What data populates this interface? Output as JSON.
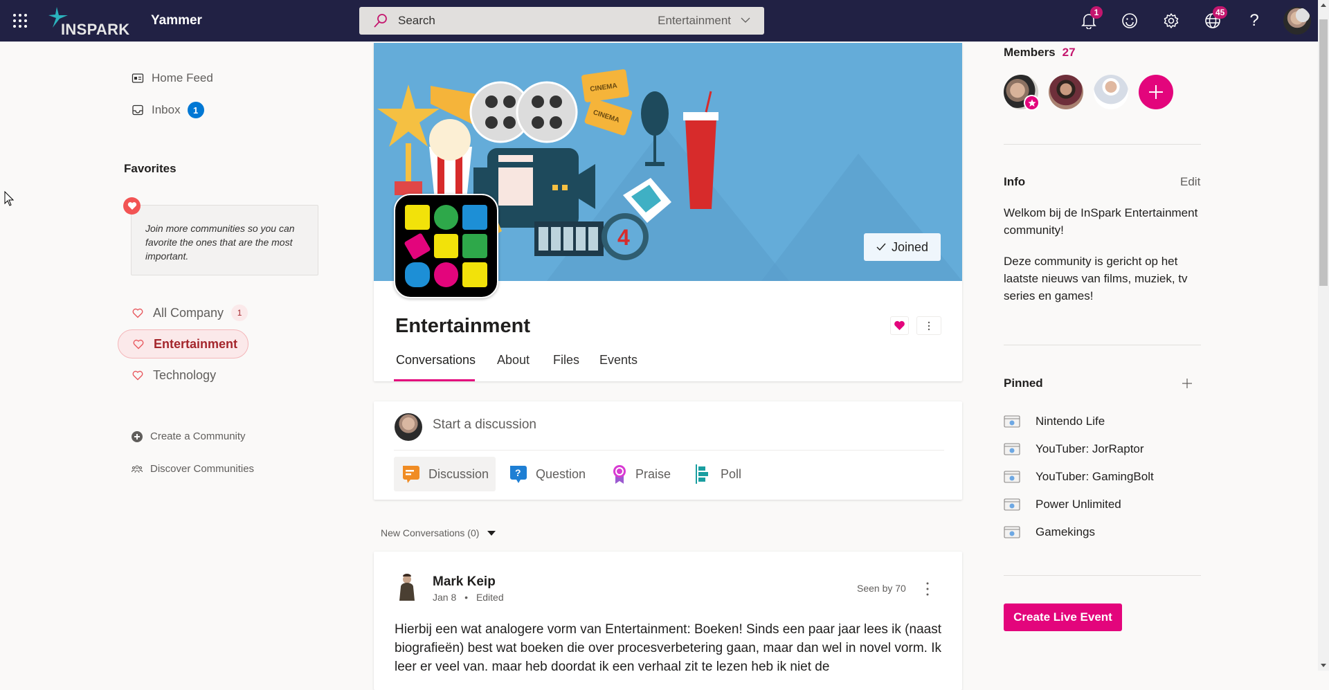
{
  "topbar": {
    "brand": "INSPARK",
    "app_name": "Yammer",
    "search": {
      "placeholder": "Search",
      "scope": "Entertainment"
    },
    "notifications_badge": "1",
    "globe_badge": "45",
    "icons": [
      "waffle-icon",
      "bell-icon",
      "smiley-icon",
      "gear-icon",
      "globe-icon",
      "help-icon"
    ]
  },
  "sidebar": {
    "nav": [
      {
        "label": "Home Feed",
        "icon": "news-icon"
      },
      {
        "label": "Inbox",
        "icon": "inbox-icon",
        "badge": "1"
      }
    ],
    "favorites_title": "Favorites",
    "favorites_tip": "Join more communities so you can favorite the ones that are the most important.",
    "communities": [
      {
        "label": "All Company",
        "count": "1",
        "active": false
      },
      {
        "label": "Entertainment",
        "active": true
      },
      {
        "label": "Technology",
        "active": false
      }
    ],
    "actions": [
      {
        "label": "Create a Community",
        "icon": "plus-circle-icon"
      },
      {
        "label": "Discover Communities",
        "icon": "people-icon"
      }
    ]
  },
  "community": {
    "name": "Entertainment",
    "joined_label": "Joined",
    "tabs": [
      {
        "label": "Conversations",
        "active": true
      },
      {
        "label": "About",
        "active": false
      },
      {
        "label": "Files",
        "active": false
      },
      {
        "label": "Events",
        "active": false
      }
    ],
    "colors": {
      "accent": "#e3057c",
      "banner": "#64acd9"
    }
  },
  "composer": {
    "placeholder": "Start a discussion",
    "types": [
      {
        "label": "Discussion",
        "active": true
      },
      {
        "label": "Question",
        "active": false
      },
      {
        "label": "Praise",
        "active": false
      },
      {
        "label": "Poll",
        "active": false
      }
    ]
  },
  "feed": {
    "filter_label": "New Conversations (0)",
    "posts": [
      {
        "author": "Mark Keip",
        "date": "Jan 8",
        "edited": "Edited",
        "seen": "Seen by 70",
        "body": "Hierbij een wat analogere vorm van Entertainment: Boeken! Sinds een paar jaar lees ik (naast biografieën) best wat boeken die over procesverbetering gaan, maar dan wel in novel vorm. Ik leer er veel van, maar heb doordat ik een verhaal zit te lezen heb ik niet de"
      }
    ]
  },
  "rightpanel": {
    "members_title": "Members",
    "members_count": "27",
    "info_title": "Info",
    "edit_label": "Edit",
    "info_paragraphs": [
      "Welkom bij de InSpark Entertainment community!",
      "Deze community is gericht op het laatste nieuws van films, muziek, tv series en games!"
    ],
    "pinned_title": "Pinned",
    "pinned": [
      "Nintendo Life",
      "YouTuber: JorRaptor",
      "YouTuber: GamingBolt",
      "Power Unlimited",
      "Gamekings"
    ],
    "live_event_label": "Create Live Event"
  }
}
